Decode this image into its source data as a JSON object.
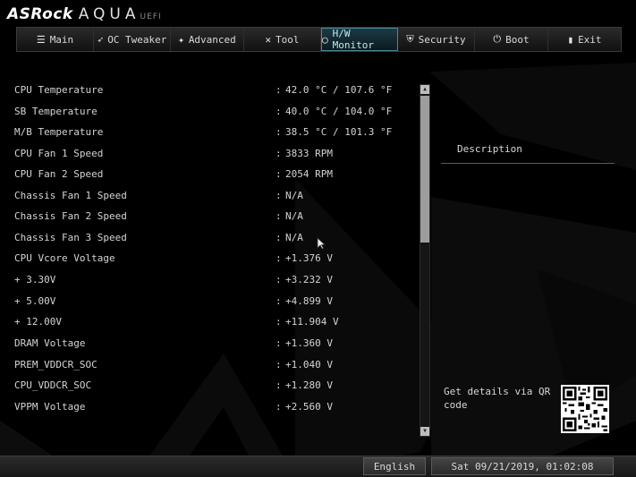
{
  "header": {
    "brand": "ASRock",
    "product": "AQUA",
    "suffix": "UEFI"
  },
  "tabs": [
    {
      "label": "Main",
      "icon": "list-icon",
      "glyph": "☰",
      "active": false
    },
    {
      "label": "OC Tweaker",
      "icon": "rocket-icon",
      "glyph": "🚀",
      "active": false
    },
    {
      "label": "Advanced",
      "icon": "star-icon",
      "glyph": "✦",
      "active": false
    },
    {
      "label": "Tool",
      "icon": "wrench-icon",
      "glyph": "✕",
      "active": false
    },
    {
      "label": "H/W Monitor",
      "icon": "monitor-icon",
      "glyph": "◯",
      "active": true
    },
    {
      "label": "Security",
      "icon": "shield-icon",
      "glyph": "⛨",
      "active": false
    },
    {
      "label": "Boot",
      "icon": "power-icon",
      "glyph": "⏻",
      "active": false
    },
    {
      "label": "Exit",
      "icon": "exit-icon",
      "glyph": "▮",
      "active": false
    }
  ],
  "readings": [
    {
      "label": "CPU Temperature",
      "value": "42.0 °C / 107.6 °F"
    },
    {
      "label": "SB Temperature",
      "value": "40.0 °C / 104.0 °F"
    },
    {
      "label": "M/B Temperature",
      "value": "38.5 °C / 101.3 °F"
    },
    {
      "label": "CPU Fan 1 Speed",
      "value": "3833 RPM"
    },
    {
      "label": "CPU Fan 2 Speed",
      "value": "2054 RPM"
    },
    {
      "label": "Chassis Fan 1 Speed",
      "value": "N/A"
    },
    {
      "label": "Chassis Fan 2 Speed",
      "value": "N/A"
    },
    {
      "label": "Chassis Fan 3 Speed",
      "value": "N/A"
    },
    {
      "label": "CPU Vcore Voltage",
      "value": "+1.376 V"
    },
    {
      "label": "+ 3.30V",
      "value": "+3.232 V"
    },
    {
      "label": "+ 5.00V",
      "value": "+4.899 V"
    },
    {
      "label": "+ 12.00V",
      "value": "+11.904 V"
    },
    {
      "label": "DRAM Voltage",
      "value": "+1.360 V"
    },
    {
      "label": "PREM_VDDCR_SOC",
      "value": "+1.040 V"
    },
    {
      "label": "CPU_VDDCR_SOC",
      "value": "+1.280 V"
    },
    {
      "label": "VPPM Voltage",
      "value": "+2.560 V"
    }
  ],
  "separator": ":",
  "description": {
    "title": "Description",
    "qr_text": "Get details via QR code"
  },
  "footer": {
    "language": "English",
    "datetime": "Sat 09/21/2019, 01:02:08"
  },
  "colors": {
    "background": "#000000",
    "active_tab": "#1c3b44",
    "text": "#d4d4d4"
  }
}
